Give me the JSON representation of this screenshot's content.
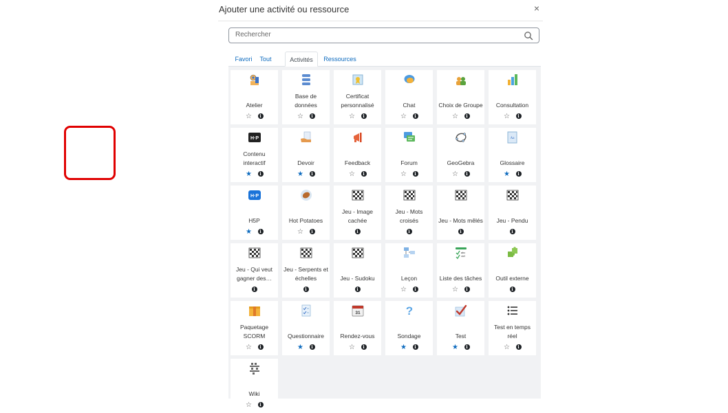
{
  "modal": {
    "title": "Ajouter une activité ou ressource",
    "close_glyph": "×"
  },
  "search": {
    "placeholder": "Rechercher"
  },
  "tabs": [
    {
      "label": "Favori",
      "active": false
    },
    {
      "label": "Tout",
      "active": false
    },
    {
      "label": "Activités",
      "active": true
    },
    {
      "label": "Ressources",
      "active": false
    }
  ],
  "colors": {
    "accent": "#0f6cbf",
    "highlight": "#e00000",
    "grid_bg": "#f1f2f4"
  },
  "activities": [
    {
      "label": "Atelier",
      "icon": "workshop-icon",
      "star": "outline"
    },
    {
      "label": "Base de données",
      "icon": "database-icon",
      "star": "outline"
    },
    {
      "label": "Certificat personnalisé",
      "icon": "certificate-icon",
      "star": "outline"
    },
    {
      "label": "Chat",
      "icon": "chat-icon",
      "star": "outline"
    },
    {
      "label": "Choix de Groupe",
      "icon": "group-choice-icon",
      "star": "outline"
    },
    {
      "label": "Consultation",
      "icon": "bar-chart-icon",
      "star": "outline"
    },
    {
      "label": "Contenu interactif",
      "icon": "h5p-dark-icon",
      "star": "filled"
    },
    {
      "label": "Devoir",
      "icon": "assignment-icon",
      "star": "filled",
      "highlighted": true
    },
    {
      "label": "Feedback",
      "icon": "megaphone-icon",
      "star": "outline"
    },
    {
      "label": "Forum",
      "icon": "forum-icon",
      "star": "outline"
    },
    {
      "label": "GeoGebra",
      "icon": "geogebra-icon",
      "star": "outline"
    },
    {
      "label": "Glossaire",
      "icon": "glossary-icon",
      "star": "filled"
    },
    {
      "label": "H5P",
      "icon": "h5p-blue-icon",
      "star": "filled"
    },
    {
      "label": "Hot Potatoes",
      "icon": "hot-potatoes-icon",
      "star": "outline"
    },
    {
      "label": "Jeu - Image cachée",
      "icon": "game-icon",
      "star": "none"
    },
    {
      "label": "Jeu - Mots croisés",
      "icon": "game-icon",
      "star": "none"
    },
    {
      "label": "Jeu - Mots mêlés",
      "icon": "game-icon",
      "star": "none"
    },
    {
      "label": "Jeu - Pendu",
      "icon": "game-icon",
      "star": "none"
    },
    {
      "label": "Jeu - Qui veut gagner des…",
      "icon": "game-icon",
      "star": "none"
    },
    {
      "label": "Jeu - Serpents et échelles",
      "icon": "game-icon",
      "star": "none"
    },
    {
      "label": "Jeu - Sudoku",
      "icon": "game-icon",
      "star": "none"
    },
    {
      "label": "Leçon",
      "icon": "lesson-icon",
      "star": "outline"
    },
    {
      "label": "Liste des tâches",
      "icon": "checklist-icon",
      "star": "outline"
    },
    {
      "label": "Outil externe",
      "icon": "puzzle-icon",
      "star": "none"
    },
    {
      "label": "Paquetage SCORM",
      "icon": "scorm-package-icon",
      "star": "outline"
    },
    {
      "label": "Questionnaire",
      "icon": "questionnaire-icon",
      "star": "filled"
    },
    {
      "label": "Rendez-vous",
      "icon": "calendar-icon",
      "star": "outline"
    },
    {
      "label": "Sondage",
      "icon": "question-mark-icon",
      "star": "filled"
    },
    {
      "label": "Test",
      "icon": "quiz-check-icon",
      "star": "filled"
    },
    {
      "label": "Test en temps réel",
      "icon": "list-icon",
      "star": "outline"
    },
    {
      "label": "Wiki",
      "icon": "wiki-icon",
      "star": "outline"
    }
  ],
  "icon_glyphs": {
    "star_outline": "☆",
    "star_filled": "★",
    "info": "i"
  }
}
